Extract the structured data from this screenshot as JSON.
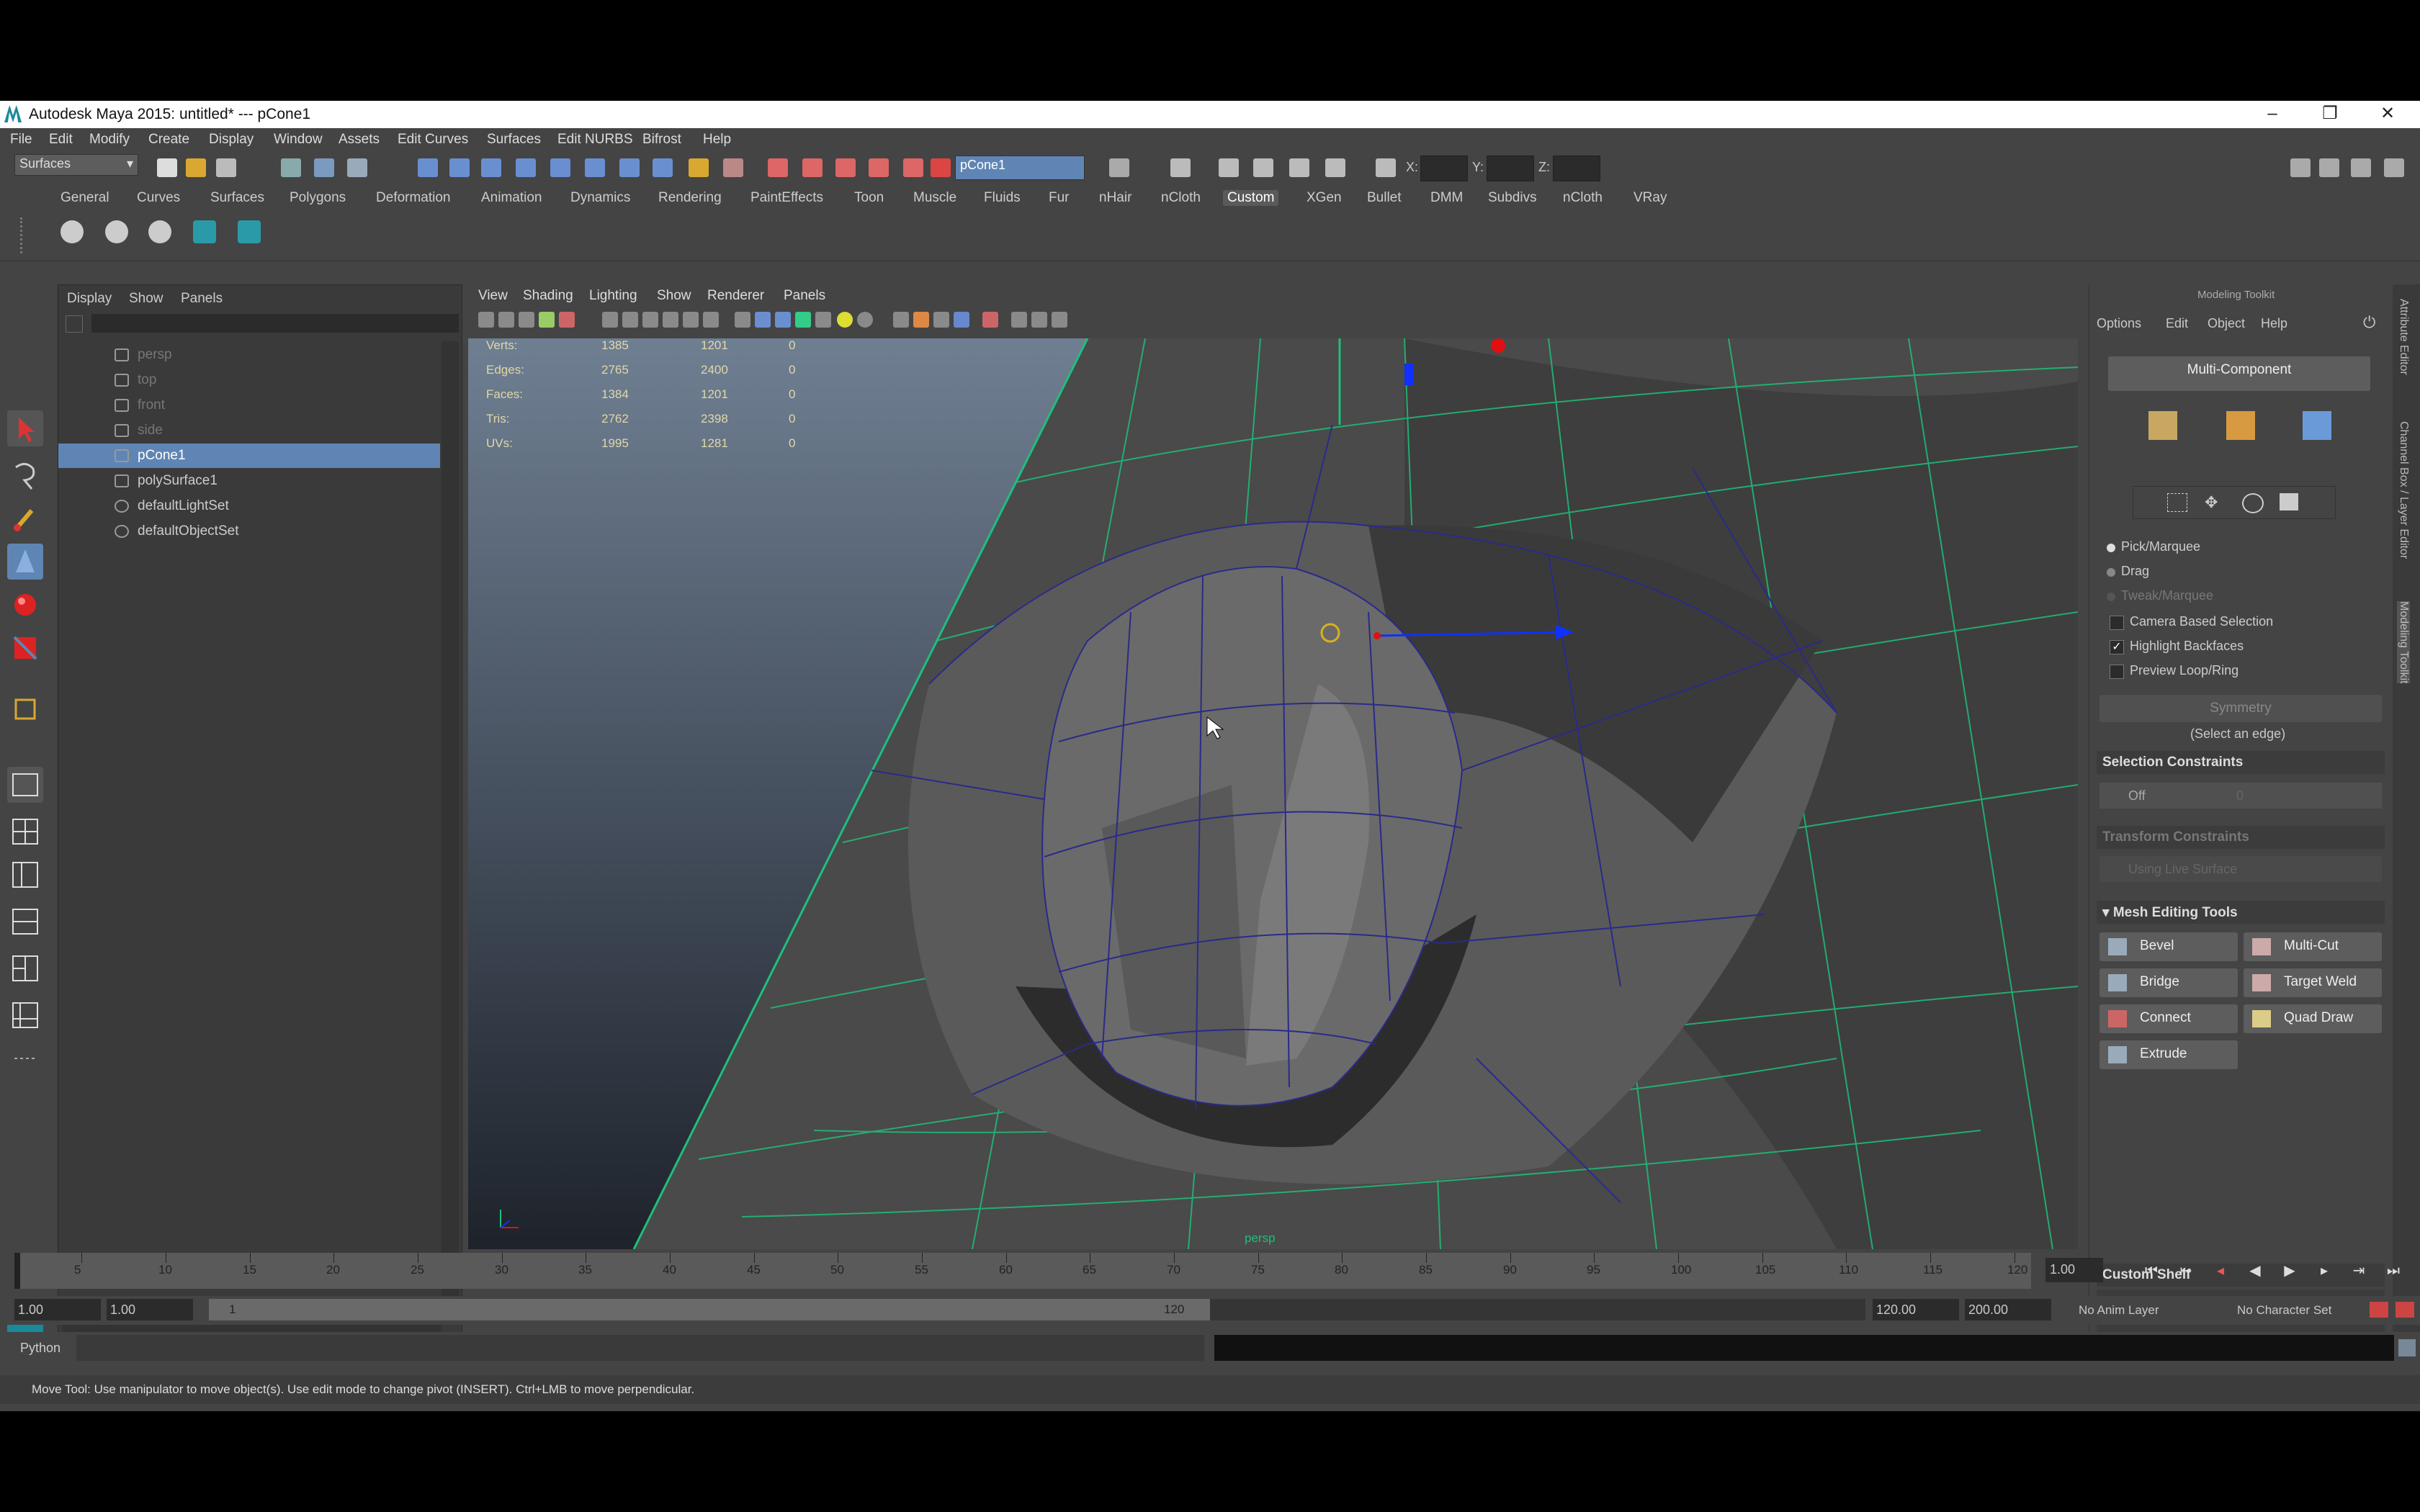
{
  "window": {
    "title": "Autodesk Maya 2015: untitled*   ---   pCone1",
    "minimize": "–",
    "restore": "❐",
    "close": "✕"
  },
  "menubar": [
    "File",
    "Edit",
    "Modify",
    "Create",
    "Display",
    "Window",
    "Assets",
    "Edit Curves",
    "Surfaces",
    "Edit NURBS",
    "Bifrost",
    "Help"
  ],
  "statusline": {
    "menuset": "Surfaces",
    "selection_field": "pCone1",
    "x_label": "X:",
    "y_label": "Y:",
    "z_label": "Z:"
  },
  "shelf_tabs": [
    "General",
    "Curves",
    "Surfaces",
    "Polygons",
    "Deformation",
    "Animation",
    "Dynamics",
    "Rendering",
    "PaintEffects",
    "Toon",
    "Muscle",
    "Fluids",
    "Fur",
    "nHair",
    "nCloth",
    "Custom",
    "XGen",
    "Bullet",
    "DMM",
    "Subdivs",
    "nCloth",
    "VRay"
  ],
  "shelf_active": "Custom",
  "outliner": {
    "menu": [
      "Display",
      "Show",
      "Panels"
    ],
    "items": [
      {
        "label": "persp",
        "state": "dim"
      },
      {
        "label": "top",
        "state": "dim"
      },
      {
        "label": "front",
        "state": "dim"
      },
      {
        "label": "side",
        "state": "dim"
      },
      {
        "label": "pCone1",
        "state": "selected"
      },
      {
        "label": "polySurface1",
        "state": "normal"
      },
      {
        "label": "defaultLightSet",
        "state": "normal"
      },
      {
        "label": "defaultObjectSet",
        "state": "normal"
      }
    ]
  },
  "viewport": {
    "menu": [
      "View",
      "Shading",
      "Lighting",
      "Show",
      "Renderer",
      "Panels"
    ],
    "camera_label": "persp",
    "hud": [
      {
        "label": "Verts:",
        "a": "1385",
        "b": "1201",
        "c": "0"
      },
      {
        "label": "Edges:",
        "a": "2765",
        "b": "2400",
        "c": "0"
      },
      {
        "label": "Faces:",
        "a": "1384",
        "b": "1201",
        "c": "0"
      },
      {
        "label": "Tris:",
        "a": "2762",
        "b": "2398",
        "c": "0"
      },
      {
        "label": "UVs:",
        "a": "1995",
        "b": "1281",
        "c": "0"
      }
    ]
  },
  "modeling_toolkit": {
    "title": "Modeling Toolkit",
    "menu": [
      "Options",
      "Edit",
      "Object",
      "Help"
    ],
    "mode_button": "Multi-Component",
    "pick_options": [
      "Pick/Marquee",
      "Drag",
      "Tweak/Marquee"
    ],
    "checkboxes": [
      {
        "label": "Camera Based Selection",
        "checked": false
      },
      {
        "label": "Highlight Backfaces",
        "checked": true
      },
      {
        "label": "Preview Loop/Ring",
        "checked": false
      }
    ],
    "symmetry": "Symmetry",
    "select_edge": "(Select an edge)",
    "selection_constraints": "Selection Constraints",
    "constraint_value": "Off",
    "constraint_num": "0",
    "transform_constraints": "Transform Constraints",
    "live_surface": "Using Live Surface",
    "mesh_editing_tools": "Mesh Editing Tools",
    "tools": [
      "Bevel",
      "Multi-Cut",
      "Bridge",
      "Target Weld",
      "Connect",
      "Quad Draw",
      "Extrude"
    ],
    "custom_shelf": "Custom Shelf"
  },
  "side_tabs": [
    "Attribute Editor",
    "Channel Box / Layer Editor",
    "Modeling Toolkit"
  ],
  "timeline": {
    "ticks": [
      "5",
      "10",
      "15",
      "20",
      "25",
      "30",
      "35",
      "40",
      "45",
      "50",
      "55",
      "60",
      "65",
      "70",
      "75",
      "80",
      "85",
      "90",
      "95",
      "100",
      "105",
      "110",
      "115",
      "120"
    ],
    "current_frame": "1.00",
    "range_start": "1.00",
    "range_start2": "1.00",
    "range_inner_start": "1",
    "range_inner_end": "120",
    "range_end": "120.00",
    "range_end2": "200.00",
    "anim_layer": "No Anim Layer",
    "character_set": "No Character Set"
  },
  "cmdline": {
    "label": "Python"
  },
  "helpline": "Move Tool: Use manipulator to move object(s). Use edit mode to change pivot (INSERT). Ctrl+LMB to move perpendicular.",
  "colors": {
    "selection": "#5f85b4",
    "wireframe_green": "#1fbf7a",
    "wireframe_blue": "#2a2a8a",
    "manip_blue": "#1030ff",
    "manip_red": "#e01010",
    "manip_yellow": "#d8b020"
  }
}
